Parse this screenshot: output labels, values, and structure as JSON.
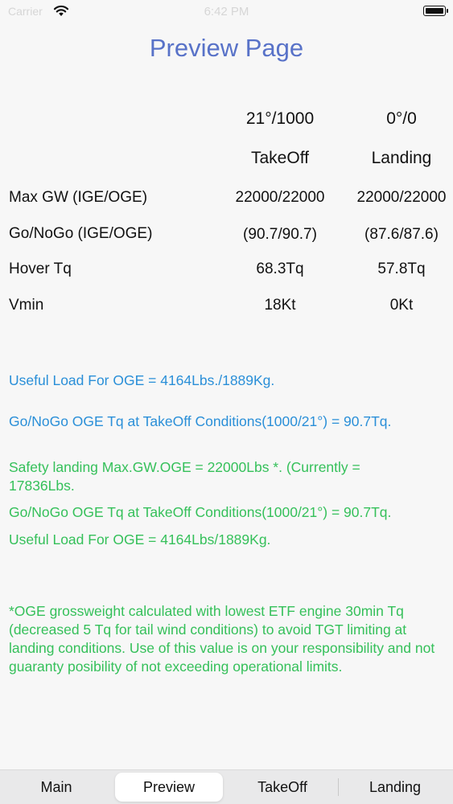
{
  "status": {
    "carrier": "Carrier",
    "time": "6:42 PM"
  },
  "title": "Preview Page",
  "headers": {
    "takeoff_cond": "21°/1000",
    "landing_cond": "0°/0",
    "takeoff": "TakeOff",
    "landing": "Landing"
  },
  "rows": [
    {
      "label": "Max GW (IGE/OGE)",
      "takeoff": "22000/22000",
      "landing": "22000/22000"
    },
    {
      "label": "Go/NoGo (IGE/OGE)",
      "takeoff": "(90.7/90.7)",
      "landing": "(87.6/87.6)"
    },
    {
      "label": "Hover Tq",
      "takeoff": "68.3Tq",
      "landing": "57.8Tq"
    },
    {
      "label": "Vmin",
      "takeoff": "18Kt",
      "landing": "0Kt"
    }
  ],
  "blue_messages": [
    "Useful Load For OGE = 4164Lbs./1889Kg.",
    "Go/NoGo OGE Tq at TakeOff Conditions(1000/21°) = 90.7Tq."
  ],
  "green_messages": [
    "Safety landing Max.GW.OGE = 22000Lbs *. (Currently = 17836Lbs.",
    "Go/NoGo OGE Tq at TakeOff Conditions(1000/21°) = 90.7Tq.",
    "Useful Load For OGE = 4164Lbs/1889Kg."
  ],
  "footnote": "*OGE grossweight calculated with lowest ETF engine 30min Tq (decreased 5 Tq for tail wind conditions) to avoid TGT limiting at landing conditions. Use of this value is on your responsibility and not guaranty posibility of not exceeding operational limits.",
  "tabs": {
    "main": "Main",
    "preview": "Preview",
    "takeoff": "TakeOff",
    "landing": "Landing",
    "selected": "Preview"
  },
  "colors": {
    "title": "#5872c8",
    "blue_text": "#2a8fd8",
    "green_text": "#35c05a"
  }
}
